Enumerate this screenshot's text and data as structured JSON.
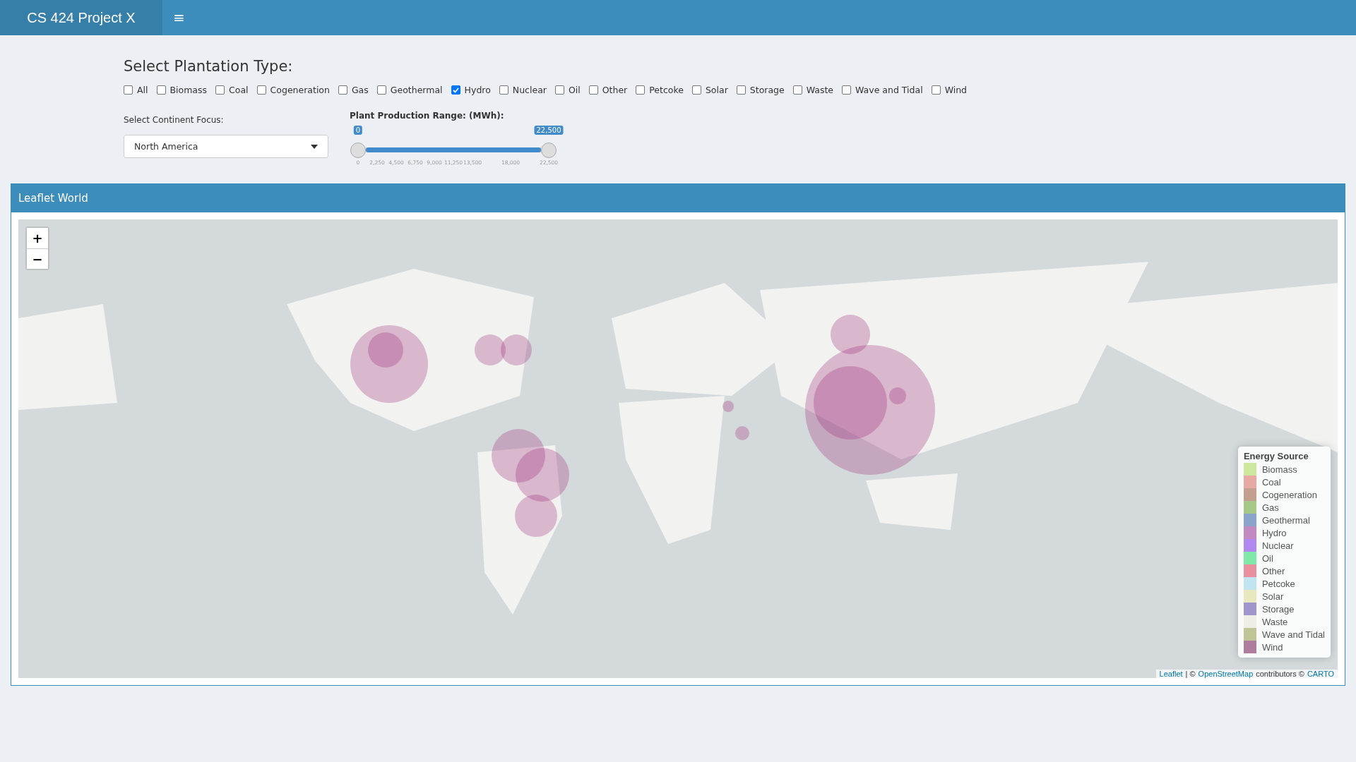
{
  "header": {
    "title": "CS 424 Project X",
    "menu_glyph": "≡"
  },
  "plantation": {
    "heading": "Select Plantation Type:",
    "options": [
      {
        "label": "All",
        "checked": false
      },
      {
        "label": "Biomass",
        "checked": false
      },
      {
        "label": "Coal",
        "checked": false
      },
      {
        "label": "Cogeneration",
        "checked": false
      },
      {
        "label": "Gas",
        "checked": false
      },
      {
        "label": "Geothermal",
        "checked": false
      },
      {
        "label": "Hydro",
        "checked": true
      },
      {
        "label": "Nuclear",
        "checked": false
      },
      {
        "label": "Oil",
        "checked": false
      },
      {
        "label": "Other",
        "checked": false
      },
      {
        "label": "Petcoke",
        "checked": false
      },
      {
        "label": "Solar",
        "checked": false
      },
      {
        "label": "Storage",
        "checked": false
      },
      {
        "label": "Waste",
        "checked": false
      },
      {
        "label": "Wave and Tidal",
        "checked": false
      },
      {
        "label": "Wind",
        "checked": false
      }
    ]
  },
  "continent": {
    "label": "Select Continent Focus:",
    "value": "North America"
  },
  "range": {
    "label": "Plant Production Range: (MWh):",
    "from_label": "0",
    "to_label": "22,500",
    "level": 1,
    "ticks": [
      "0",
      "2,250",
      "4,500",
      "6,750",
      "9,000",
      "11,250",
      "13,500",
      "18,000",
      "22,500"
    ]
  },
  "map_box": {
    "title": "Leaflet World",
    "zoom_in": "+",
    "zoom_out": "−",
    "legend": {
      "title": "Energy Source",
      "items": [
        {
          "label": "Biomass",
          "color": "#cde89e"
        },
        {
          "label": "Coal",
          "color": "#e8a8a4"
        },
        {
          "label": "Cogeneration",
          "color": "#c49e8e"
        },
        {
          "label": "Gas",
          "color": "#a8c88a"
        },
        {
          "label": "Geothermal",
          "color": "#8aa4cc"
        },
        {
          "label": "Hydro",
          "color": "#c28ac0"
        },
        {
          "label": "Nuclear",
          "color": "#b088f0"
        },
        {
          "label": "Oil",
          "color": "#80e8a8"
        },
        {
          "label": "Other",
          "color": "#e8909e"
        },
        {
          "label": "Petcoke",
          "color": "#c0e4f0"
        },
        {
          "label": "Solar",
          "color": "#e8e8c0"
        },
        {
          "label": "Storage",
          "color": "#a096cc"
        },
        {
          "label": "Waste",
          "color": "#eeeee4"
        },
        {
          "label": "Wave and Tidal",
          "color": "#c0c496"
        },
        {
          "label": "Wind",
          "color": "#b07c9e"
        }
      ]
    },
    "attribution": {
      "link1": "Leaflet",
      "sep": "| ©",
      "link2": "OpenStreetMap",
      "text": "contributors ©",
      "link3": "CARTO"
    }
  }
}
